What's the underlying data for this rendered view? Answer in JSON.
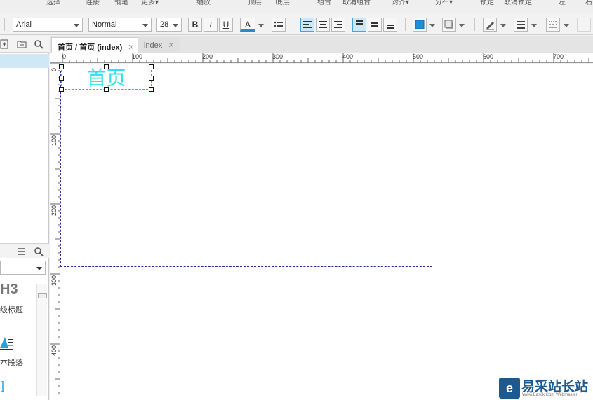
{
  "menu": {
    "items": [
      "选择",
      "连接",
      "钢笔",
      "更多▾",
      "缩放",
      "顶层",
      "底层",
      "组合",
      "取消组合",
      "对齐▾",
      "分布▾",
      "锁定",
      "取消锁定",
      "左",
      "右"
    ]
  },
  "toolbar": {
    "font_family": "Arial",
    "font_style": "Normal",
    "font_size": "28",
    "bold": "B",
    "italic": "I",
    "underline": "U",
    "font_color_glyph": "A",
    "accent": "#1e8fd6"
  },
  "tabs": [
    {
      "label": "首页 / 首页 (index)",
      "close": "✕"
    },
    {
      "label": "index",
      "close": "✕"
    }
  ],
  "ruler": {
    "h_labels": [
      "0",
      "100",
      "200",
      "300",
      "400",
      "500",
      "600",
      "700"
    ],
    "v_labels": [
      "0",
      "100",
      "200",
      "300",
      "400"
    ]
  },
  "widgets_panel": {
    "h3_label": "H3",
    "h3_caption": "级标题",
    "paragraph_caption": "本段落"
  },
  "canvas": {
    "widget_text": "首页",
    "widget_text_color": "#2fe0ee"
  },
  "watermark": {
    "logo_glyph": "e",
    "text": "易采站长站",
    "subtext": "Www.Easck.Com  Webmaster"
  }
}
